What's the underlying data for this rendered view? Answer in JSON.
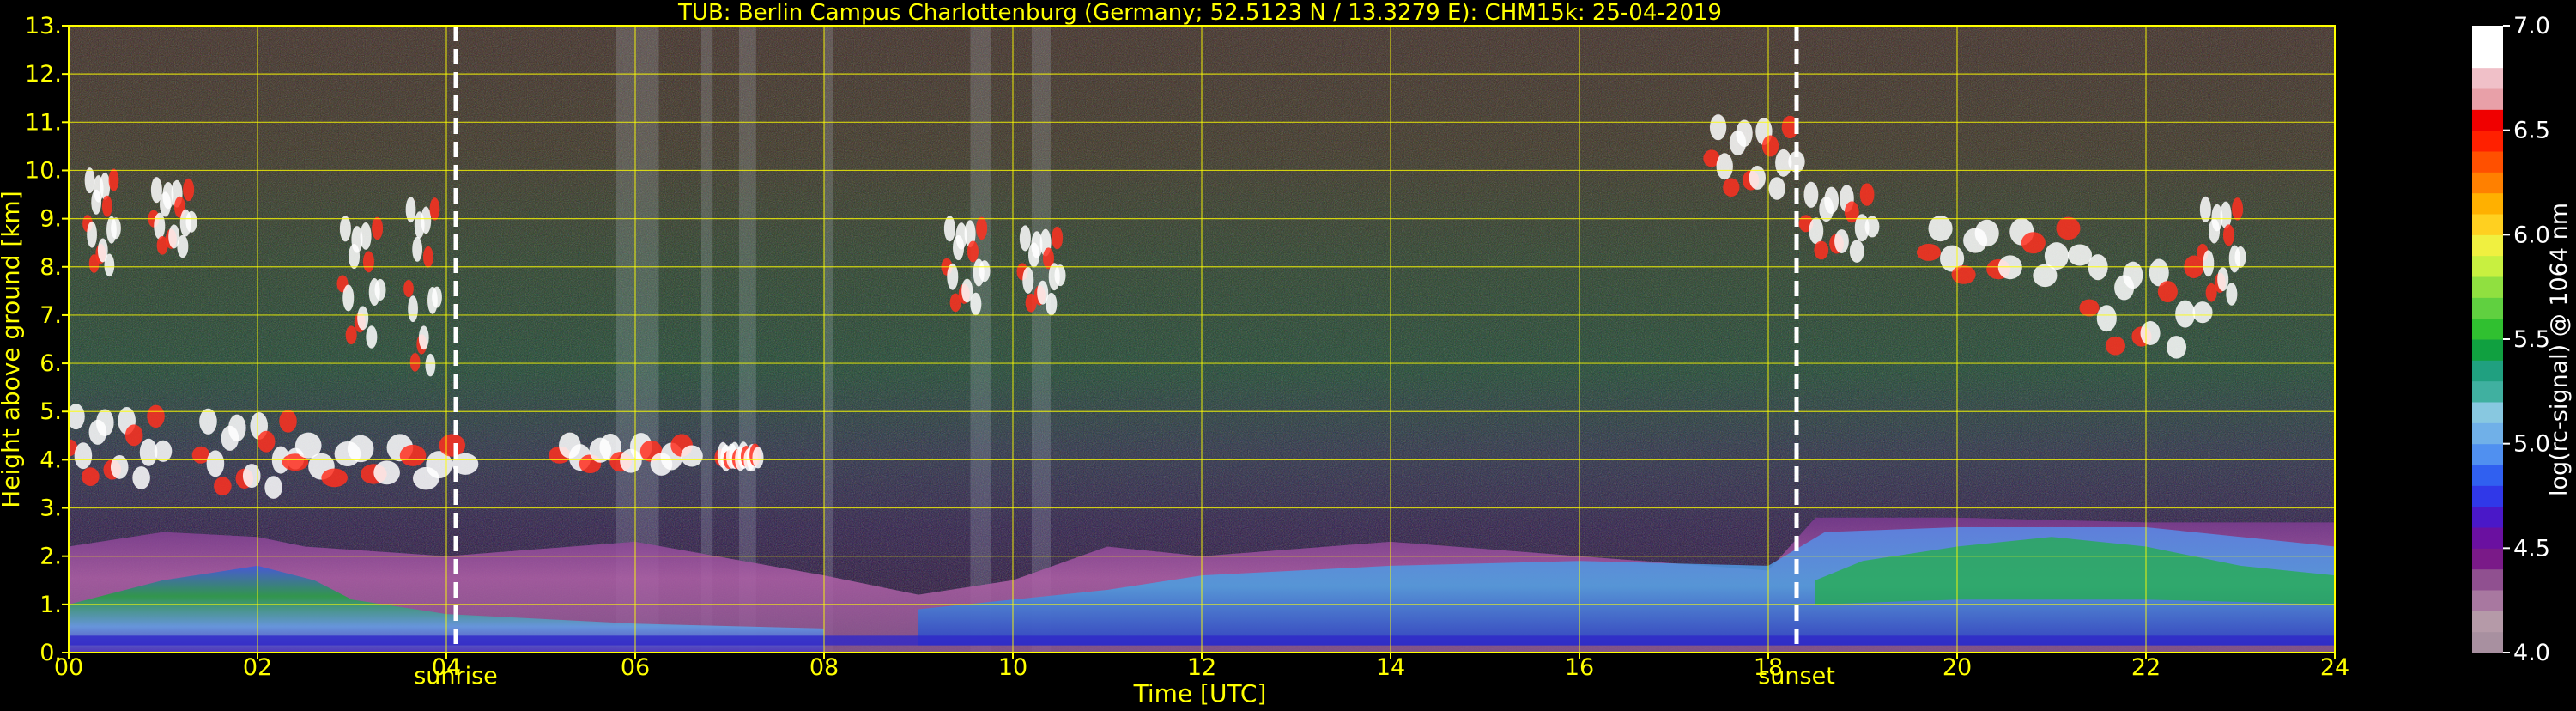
{
  "chart_data": {
    "type": "heatmap",
    "title": "TUB: Berlin Campus Charlottenburg (Germany; 52.5123 N / 13.3279 E):    CHM15k: 25-04-2019",
    "xlabel": "Time [UTC]",
    "ylabel": "Height above ground [km]",
    "xlim": [
      0,
      24
    ],
    "ylim": [
      0,
      13
    ],
    "x_ticks": [
      "00",
      "02",
      "04",
      "06",
      "08",
      "10",
      "12",
      "14",
      "16",
      "18",
      "20",
      "22",
      "24"
    ],
    "y_ticks": [
      "0.",
      "1.",
      "2.",
      "3.",
      "4.",
      "5.",
      "6.",
      "7.",
      "8.",
      "9.",
      "10.",
      "11.",
      "12.",
      "13."
    ],
    "grid": true,
    "annotations": [
      {
        "label": "sunrise",
        "x": 4.1
      },
      {
        "label": "sunset",
        "x": 18.3
      }
    ],
    "colorbar": {
      "label": "log(rc-signal) @ 1064 nm",
      "range": [
        4.0,
        7.0
      ],
      "ticks": [
        "4.0",
        "4.5",
        "5.0",
        "5.5",
        "6.0",
        "6.5",
        "7.0"
      ],
      "colors": [
        "#a890a0",
        "#b59aa8",
        "#a878a0",
        "#905090",
        "#7a1a88",
        "#6a10a0",
        "#4a18c8",
        "#3038e8",
        "#3060f0",
        "#5090f0",
        "#70b0e8",
        "#88c8e0",
        "#40b0a0",
        "#20a080",
        "#10a040",
        "#30c030",
        "#60d040",
        "#90e040",
        "#c8f040",
        "#f0f040",
        "#ffd020",
        "#ffb000",
        "#ff8000",
        "#ff5000",
        "#ff2000",
        "#f00000",
        "#e8a0a8",
        "#f0c0c8",
        "#ffffff",
        "#ffffff"
      ]
    },
    "features": [
      {
        "kind": "boundary-layer",
        "x_range": [
          0,
          24
        ],
        "height_km": [
          0.2,
          2.8
        ]
      },
      {
        "kind": "mid-level-cloud",
        "x_range": [
          0,
          7.2
        ],
        "height_km": [
          3.6,
          4.9
        ]
      },
      {
        "kind": "cirrus",
        "x_range": [
          9.3,
          10.6
        ],
        "height_km": [
          6.8,
          9.5
        ]
      },
      {
        "kind": "cirrus",
        "x_range": [
          17.4,
          18.3
        ],
        "height_km": [
          9.3,
          11.0
        ]
      },
      {
        "kind": "cirrus",
        "x_range": [
          18.4,
          23.0
        ],
        "height_km": [
          6.2,
          9.5
        ]
      }
    ]
  }
}
